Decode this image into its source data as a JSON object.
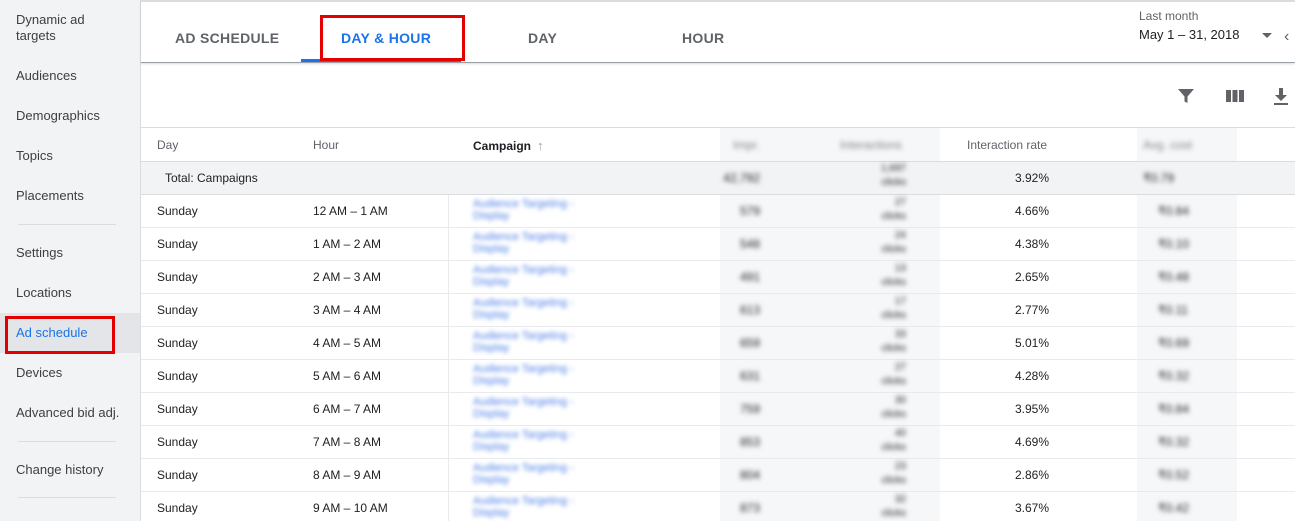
{
  "sidebar": {
    "items": [
      {
        "label": "Dynamic ad\ntargets"
      },
      {
        "label": "Audiences"
      },
      {
        "label": "Demographics"
      },
      {
        "label": "Topics"
      },
      {
        "label": "Placements"
      },
      {
        "label": "Settings"
      },
      {
        "label": "Locations"
      },
      {
        "label": "Ad schedule"
      },
      {
        "label": "Devices"
      },
      {
        "label": "Advanced bid adj."
      },
      {
        "label": "Change history"
      }
    ],
    "active": "Ad schedule"
  },
  "tabs": [
    {
      "label": "AD SCHEDULE"
    },
    {
      "label": "DAY & HOUR"
    },
    {
      "label": "DAY"
    },
    {
      "label": "HOUR"
    }
  ],
  "active_tab": "DAY & HOUR",
  "date_range": {
    "label": "Last month",
    "value": "May 1 – 31, 2018"
  },
  "toolbar": {
    "icons": [
      "filter-icon",
      "columns-icon",
      "download-icon"
    ]
  },
  "table": {
    "headers": {
      "day": "Day",
      "hour": "Hour",
      "campaign": "Campaign",
      "impr": "Impr.",
      "interactions": "Interactions",
      "interaction_rate": "Interaction rate",
      "avg_cost": "Avg. cost"
    },
    "total": {
      "label": "Total: Campaigns",
      "impr": "42,792",
      "interactions": "1,697",
      "interactions_sub": "clicks",
      "interaction_rate": "3.92%",
      "avg_cost": "₹0.79"
    },
    "rows": [
      {
        "day": "Sunday",
        "hour": "12 AM – 1 AM",
        "campaign": "Audience Targeting - Display",
        "impr": "579",
        "interactions": "27",
        "interactions_sub": "clicks",
        "interaction_rate": "4.66%",
        "avg_cost": "₹0.84"
      },
      {
        "day": "Sunday",
        "hour": "1 AM – 2 AM",
        "campaign": "Audience Targeting - Display",
        "impr": "548",
        "interactions": "24",
        "interactions_sub": "clicks",
        "interaction_rate": "4.38%",
        "avg_cost": "₹0.10"
      },
      {
        "day": "Sunday",
        "hour": "2 AM – 3 AM",
        "campaign": "Audience Targeting - Display",
        "impr": "491",
        "interactions": "13",
        "interactions_sub": "clicks",
        "interaction_rate": "2.65%",
        "avg_cost": "₹0.48"
      },
      {
        "day": "Sunday",
        "hour": "3 AM – 4 AM",
        "campaign": "Audience Targeting - Display",
        "impr": "613",
        "interactions": "17",
        "interactions_sub": "clicks",
        "interaction_rate": "2.77%",
        "avg_cost": "₹0.11"
      },
      {
        "day": "Sunday",
        "hour": "4 AM – 5 AM",
        "campaign": "Audience Targeting - Display",
        "impr": "659",
        "interactions": "33",
        "interactions_sub": "clicks",
        "interaction_rate": "5.01%",
        "avg_cost": "₹0.69"
      },
      {
        "day": "Sunday",
        "hour": "5 AM – 6 AM",
        "campaign": "Audience Targeting - Display",
        "impr": "631",
        "interactions": "27",
        "interactions_sub": "clicks",
        "interaction_rate": "4.28%",
        "avg_cost": "₹0.32"
      },
      {
        "day": "Sunday",
        "hour": "6 AM – 7 AM",
        "campaign": "Audience Targeting - Display",
        "impr": "759",
        "interactions": "30",
        "interactions_sub": "clicks",
        "interaction_rate": "3.95%",
        "avg_cost": "₹0.84"
      },
      {
        "day": "Sunday",
        "hour": "7 AM – 8 AM",
        "campaign": "Audience Targeting - Display",
        "impr": "853",
        "interactions": "40",
        "interactions_sub": "clicks",
        "interaction_rate": "4.69%",
        "avg_cost": "₹0.32"
      },
      {
        "day": "Sunday",
        "hour": "8 AM – 9 AM",
        "campaign": "Audience Targeting - Display",
        "impr": "804",
        "interactions": "23",
        "interactions_sub": "clicks",
        "interaction_rate": "2.86%",
        "avg_cost": "₹0.52"
      },
      {
        "day": "Sunday",
        "hour": "9 AM – 10 AM",
        "campaign": "Audience Targeting - Display",
        "impr": "873",
        "interactions": "32",
        "interactions_sub": "clicks",
        "interaction_rate": "3.67%",
        "avg_cost": "₹0.42"
      }
    ]
  },
  "colors": {
    "accent": "#1a73e8",
    "highlight_box": "#e50000",
    "sidebar_bg": "#f1f3f4"
  }
}
